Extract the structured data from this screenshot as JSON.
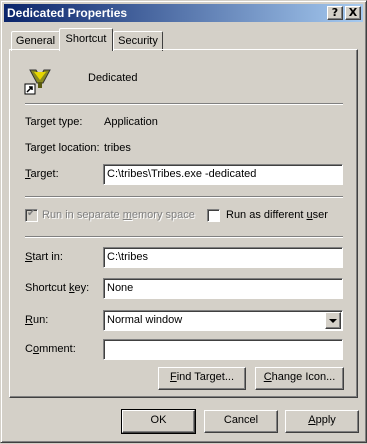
{
  "window": {
    "title": "Dedicated Properties",
    "help_label": "?",
    "close_label": "X"
  },
  "tabs": [
    {
      "label": "General"
    },
    {
      "label": "Shortcut"
    },
    {
      "label": "Security"
    }
  ],
  "shortcut": {
    "name": "Dedicated",
    "target_type_label": "Target type:",
    "target_type_value": "Application",
    "target_location_label": "Target location:",
    "target_location_value": "tribes",
    "target_label_pre": "",
    "target_label_u": "T",
    "target_label_post": "arget:",
    "target_value": "C:\\tribes\\Tribes.exe -dedicated",
    "separate_memory_pre": "Run in separate ",
    "separate_memory_u": "m",
    "separate_memory_post": "emory space",
    "different_user_pre": "Run as different ",
    "different_user_u": "u",
    "different_user_post": "ser",
    "start_in_label_pre": "",
    "start_in_label_u": "S",
    "start_in_label_post": "tart in:",
    "start_in_value": "C:\\tribes",
    "shortcut_key_label_pre": "Shortcut ",
    "shortcut_key_label_u": "k",
    "shortcut_key_label_post": "ey:",
    "shortcut_key_value": "None",
    "run_label_pre": "",
    "run_label_u": "R",
    "run_label_post": "un:",
    "run_value": "Normal window",
    "comment_label_pre": "C",
    "comment_label_u": "o",
    "comment_label_post": "mment:",
    "comment_value": "",
    "find_target_pre": "",
    "find_target_u": "F",
    "find_target_post": "ind Target...",
    "change_icon_pre": "",
    "change_icon_u": "C",
    "change_icon_post": "hange Icon..."
  },
  "footer": {
    "ok_label": "OK",
    "cancel_label": "Cancel",
    "apply_pre": "",
    "apply_u": "A",
    "apply_post": "pply"
  }
}
